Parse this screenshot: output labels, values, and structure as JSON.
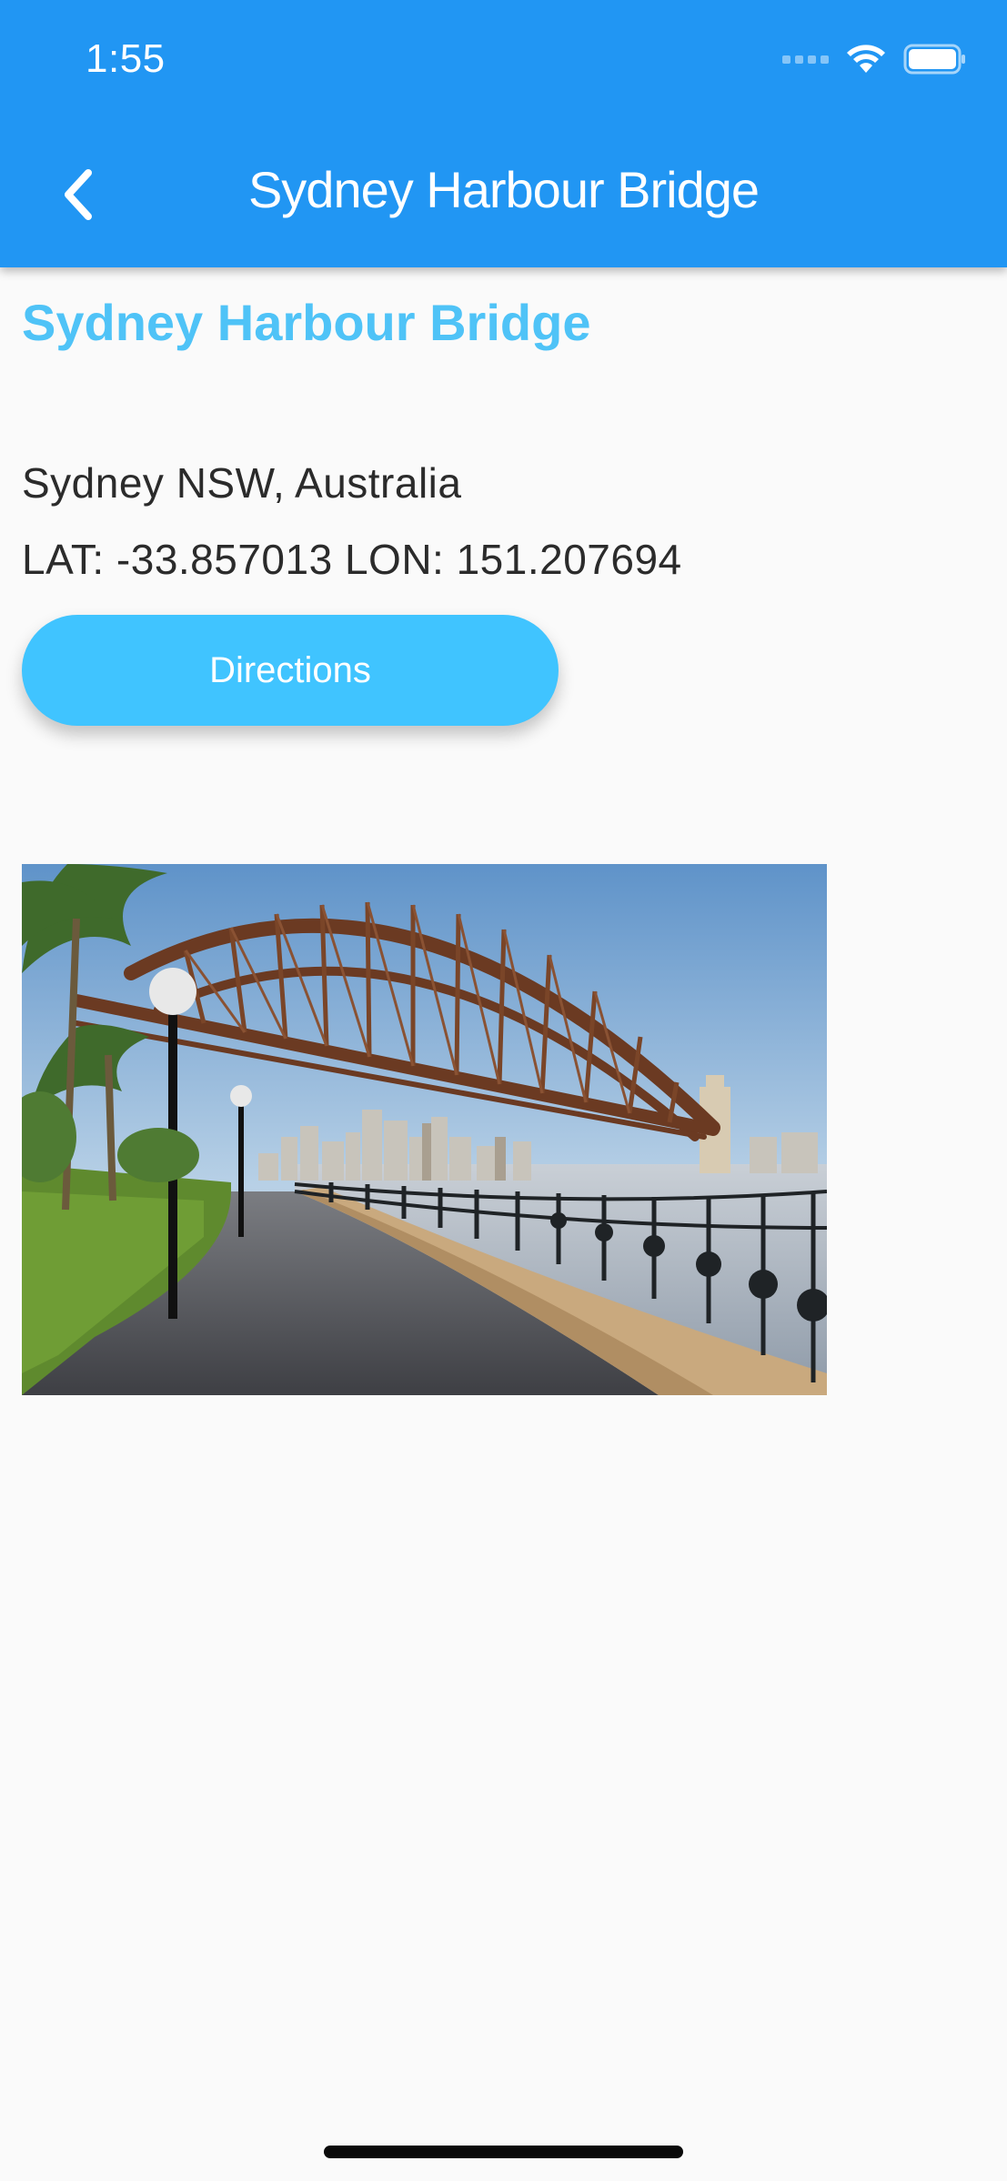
{
  "status_bar": {
    "time": "1:55",
    "icons": [
      "signal-dots-icon",
      "wifi-icon",
      "battery-icon"
    ]
  },
  "app_bar": {
    "back_icon": "chevron-left-icon",
    "title": "Sydney Harbour Bridge",
    "background_color": "#2196F3"
  },
  "place": {
    "name": "Sydney Harbour Bridge",
    "address": "Sydney NSW, Australia",
    "coordinates": "LAT: -33.857013 LON: 151.207694",
    "name_color": "#4FC3F7"
  },
  "actions": {
    "directions_label": "Directions",
    "button_color": "#40C4FF"
  },
  "photo": {
    "subject": "Sydney Harbour Bridge arch over waterfront promenade"
  }
}
